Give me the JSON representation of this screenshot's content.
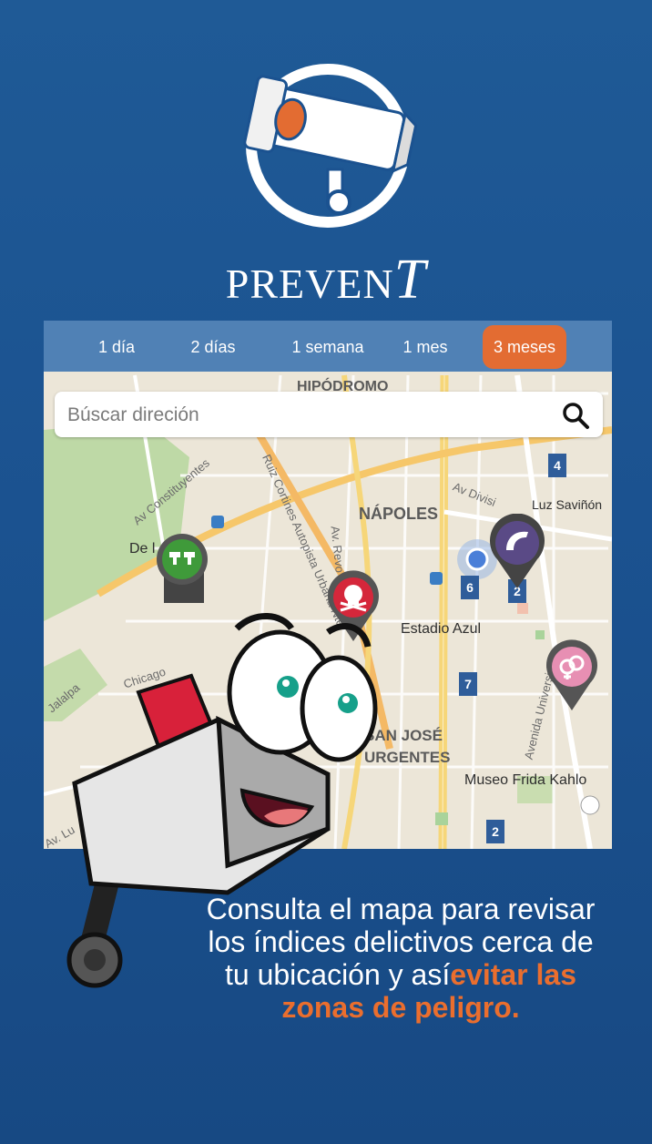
{
  "brand": {
    "name_main": "PREVEN",
    "name_last": "T"
  },
  "tabs": [
    {
      "label": "1 día",
      "active": false
    },
    {
      "label": "2 días",
      "active": false
    },
    {
      "label": "1 semana",
      "active": false
    },
    {
      "label": "1 mes",
      "active": false
    },
    {
      "label": "3 meses",
      "active": true
    }
  ],
  "search": {
    "placeholder": "Búscar direción",
    "icon": "search-icon"
  },
  "map": {
    "area_labels": [
      "HIPÓDROMO",
      "NÁPOLES",
      "SAN JOSÉ",
      "URGENTES"
    ],
    "pois": [
      "Estadio Azul",
      "Museo Frida Kahlo",
      "Luz Saviñón",
      "De l"
    ],
    "streets": [
      "Av Constituyentes",
      "Ruiz Cortines Autopista Urbana Nte",
      "Av. Revo",
      "Av Divisi",
      "Avenida Universidad",
      "Jalalpa",
      "Chicago",
      "Av. Lu"
    ],
    "cluster_badges": [
      "4",
      "6",
      "2",
      "7",
      "2"
    ],
    "pins": [
      {
        "type": "robbery-icon",
        "color": "#3f9a3a"
      },
      {
        "type": "skull-icon",
        "color": "#d5273b"
      },
      {
        "type": "phone-icon",
        "color": "#5a4a86"
      },
      {
        "type": "gender-icon",
        "color": "#e78fb3"
      }
    ]
  },
  "caption": {
    "line1": "Consulta el mapa para revisar",
    "line2": "los índices delictivos cerca de",
    "line3_start": "tu ubicación y así",
    "highlight_a": "evitar las",
    "highlight_b": "zonas de peligro."
  },
  "colors": {
    "background": "#1b5290",
    "accent": "#e36c32",
    "tabbar": "#4278b2"
  }
}
